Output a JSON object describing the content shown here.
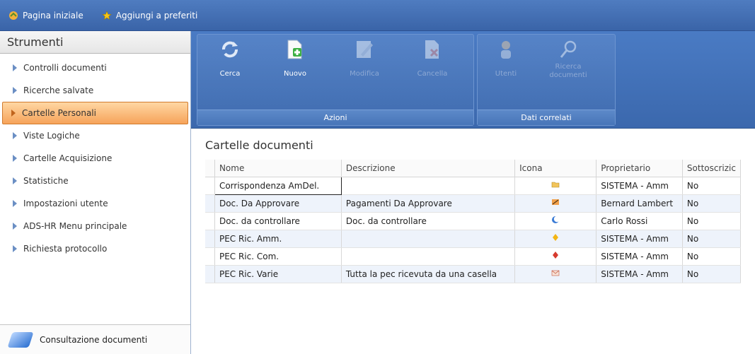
{
  "topbar": {
    "home_label": "Pagina iniziale",
    "favorites_label": "Aggiungi a preferiti"
  },
  "sidebar": {
    "title": "Strumenti",
    "items": [
      {
        "label": "Controlli documenti"
      },
      {
        "label": "Ricerche salvate"
      },
      {
        "label": "Cartelle Personali"
      },
      {
        "label": "Viste Logiche"
      },
      {
        "label": "Cartelle Acquisizione"
      },
      {
        "label": "Statistiche"
      },
      {
        "label": "Impostazioni utente"
      },
      {
        "label": "ADS-HR Menu principale"
      },
      {
        "label": "Richiesta protocollo"
      }
    ],
    "active_item": "Cartelle Personali",
    "bottom_label": "Consultazione documenti"
  },
  "ribbon": {
    "groups": [
      {
        "label": "Azioni"
      },
      {
        "label": "Dati correlati"
      }
    ],
    "buttons": {
      "cerca": "Cerca",
      "nuovo": "Nuovo",
      "modifica": "Modifica",
      "cancella": "Cancella",
      "utenti": "Utenti",
      "ricerca_line1": "Ricerca",
      "ricerca_line2": "documenti"
    }
  },
  "main": {
    "title": "Cartelle documenti",
    "columns": [
      "Nome",
      "Descrizione",
      "Icona",
      "Proprietario",
      "Sottoscrizic"
    ],
    "rows": [
      {
        "nome": "Corrispondenza AmDel.",
        "descrizione": "",
        "icona": "folder-icon",
        "proprietario": "SISTEMA - Amm",
        "sottoscrizione": "No"
      },
      {
        "nome": "Doc. Da Approvare",
        "descrizione": "Pagamenti Da Approvare",
        "icona": "pencil-icon",
        "proprietario": "Bernard Lambert",
        "sottoscrizione": "No"
      },
      {
        "nome": "Doc. da controllare",
        "descrizione": "Doc. da controllare",
        "icona": "moon-icon",
        "proprietario": "Carlo Rossi",
        "sottoscrizione": "No"
      },
      {
        "nome": "PEC Ric. Amm.",
        "descrizione": "",
        "icona": "yellow-diamond-icon",
        "proprietario": "SISTEMA - Amm",
        "sottoscrizione": "No"
      },
      {
        "nome": "PEC Ric. Com.",
        "descrizione": "",
        "icona": "red-diamond-icon",
        "proprietario": "SISTEMA - Amm",
        "sottoscrizione": "No"
      },
      {
        "nome": "PEC Ric. Varie",
        "descrizione": "Tutta la pec ricevuta da una casella",
        "icona": "mail-icon",
        "proprietario": "SISTEMA - Amm",
        "sottoscrizione": "No"
      }
    ]
  },
  "colors": {
    "ribbon_blue": "#4a7bc4",
    "active_orange": "#f6a35a",
    "alt_row": "#eef3fb"
  }
}
